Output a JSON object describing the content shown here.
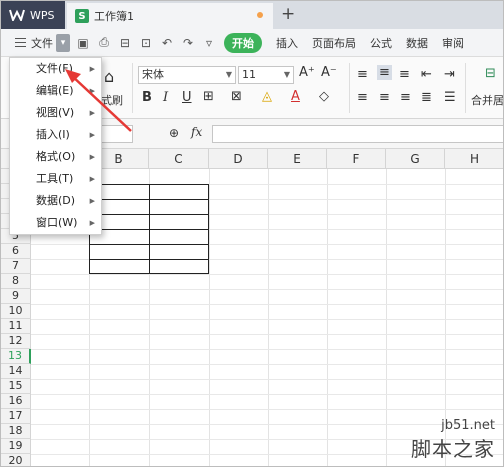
{
  "titlebar": {
    "app_tab": "WPS",
    "doc_tab": "工作簿1",
    "new_tab_symbol": "+"
  },
  "menubar": {
    "file_label": "文件",
    "start_button": "开始",
    "items": [
      "插入",
      "页面布局",
      "公式",
      "数据",
      "审阅"
    ]
  },
  "toolbar": {
    "font_name": "宋体",
    "font_size": "11",
    "format_label": "式刷",
    "merge_label": "合并居"
  },
  "formula_bar": {
    "fx_label": "fx"
  },
  "file_menu": {
    "items": [
      "文件(F)",
      "编辑(E)",
      "视图(V)",
      "插入(I)",
      "格式(O)",
      "工具(T)",
      "数据(D)",
      "窗口(W)"
    ]
  },
  "grid": {
    "columns": [
      "B",
      "C",
      "D",
      "E",
      "F",
      "G",
      "H"
    ],
    "rows": [
      "5",
      "6",
      "7",
      "8",
      "9",
      "10",
      "11",
      "12",
      "13",
      "14",
      "15",
      "16",
      "17",
      "18",
      "19",
      "20"
    ],
    "active_row": "13"
  },
  "watermark": {
    "url": "jb51.net",
    "name": "脚本之家"
  },
  "colors": {
    "accent_green": "#3cb35a",
    "wps_tab": "#3b4256",
    "annotation_red": "#e53935"
  }
}
